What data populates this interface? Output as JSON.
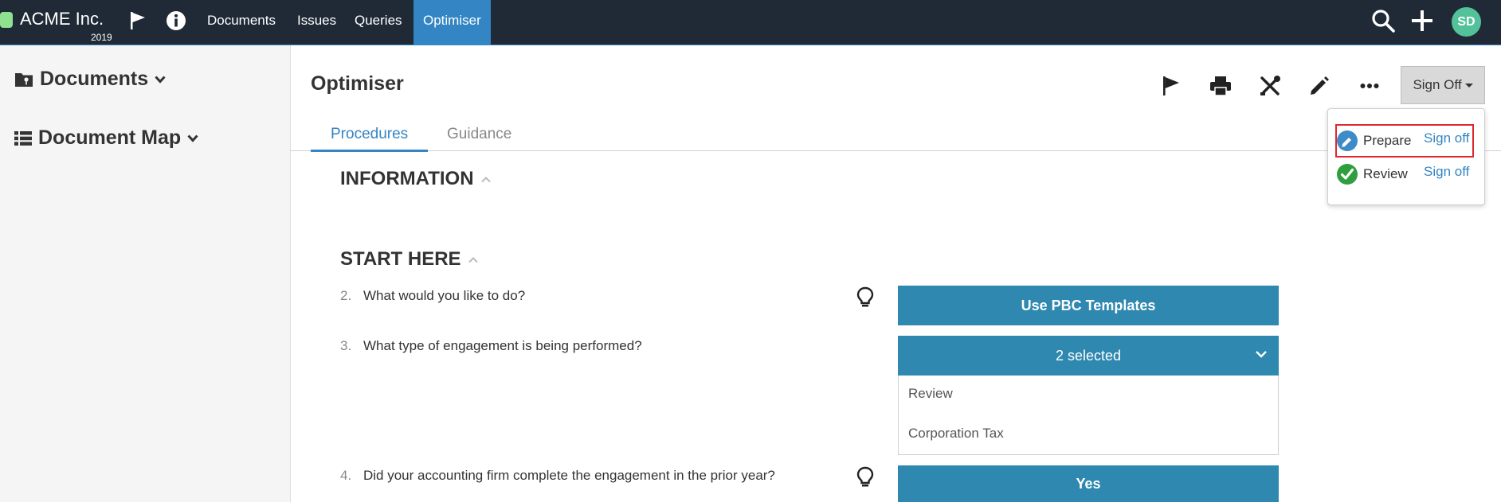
{
  "nav": {
    "brand": "ACME Inc.",
    "year": "2019",
    "links": [
      "Documents",
      "Issues",
      "Queries",
      "Optimiser"
    ],
    "active": "Optimiser",
    "avatar_initials": "SD",
    "icons": [
      "flag-icon",
      "info-icon",
      "search-icon",
      "plus-icon"
    ]
  },
  "sidebar": {
    "items": [
      {
        "label": "Documents",
        "icon": "folder-pin-icon"
      },
      {
        "label": "Document Map",
        "icon": "list-icon"
      }
    ]
  },
  "header": {
    "title": "Optimiser",
    "toolbar_icons": [
      "flag-icon",
      "print-icon",
      "tools-icon",
      "pencil-icon",
      "more-icon"
    ],
    "signoff_label": "Sign Off"
  },
  "tabs": [
    {
      "label": "Procedures",
      "active": true
    },
    {
      "label": "Guidance",
      "active": false
    }
  ],
  "sections": {
    "information": "INFORMATION",
    "start_here": "START HERE"
  },
  "questions": [
    {
      "num": "2.",
      "text": "What would you like to do?",
      "answer": "Use PBC Templates"
    },
    {
      "num": "3.",
      "text": "What type of engagement is being performed?",
      "answer": "2 selected",
      "options": [
        "Review",
        "Corporation Tax"
      ]
    },
    {
      "num": "4.",
      "text": "Did your accounting firm complete the engagement in the prior year?",
      "answer": "Yes"
    }
  ],
  "signoff_menu": [
    {
      "role": "Prepare",
      "link": "Sign off",
      "icon": "pencil-circle-icon",
      "color": "#3d8cc9"
    },
    {
      "role": "Review",
      "link": "Sign off",
      "icon": "check-circle-icon",
      "color": "#2e9e3e"
    }
  ],
  "colors": {
    "topbar": "#1f2a36",
    "accent": "#3385c3",
    "answer_button": "#2e88b0",
    "avatar": "#53c29a",
    "highlight": "#e0262f"
  }
}
